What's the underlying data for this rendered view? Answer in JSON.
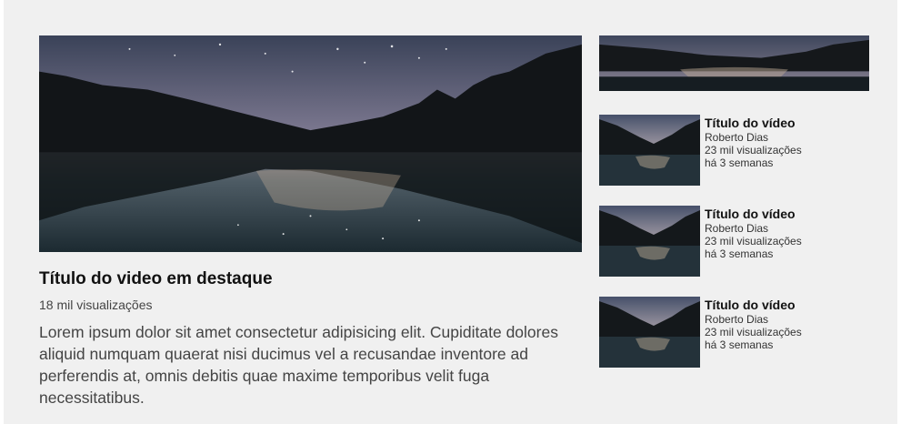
{
  "featured": {
    "thumbnail_icon": "night-lake-thumbnail",
    "title": "Título do video em destaque",
    "views": "18 mil visualizações",
    "description": "Lorem ipsum dolor sit amet consectetur adipisicing elit. Cupiditate dolores aliquid numquam quaerat nisi ducimus vel a recusandae inventore ad perferendis at, omnis debitis quae maxime temporibus velit fuga necessitatibus."
  },
  "banner": {
    "icon": "night-lake-banner"
  },
  "videos": [
    {
      "title": "Título do vídeo",
      "channel": "Roberto Dias",
      "views": "23 mil visualizações",
      "date": "há 3 semanas"
    },
    {
      "title": "Título do vídeo",
      "channel": "Roberto Dias",
      "views": "23 mil visualizações",
      "date": "há 3 semanas"
    },
    {
      "title": "Título do vídeo",
      "channel": "Roberto Dias",
      "views": "23 mil visualizações",
      "date": "há 3 semanas"
    }
  ],
  "colors": {
    "page_background": "#f0f0f0",
    "title_text": "#111111",
    "meta_text": "#444444"
  }
}
